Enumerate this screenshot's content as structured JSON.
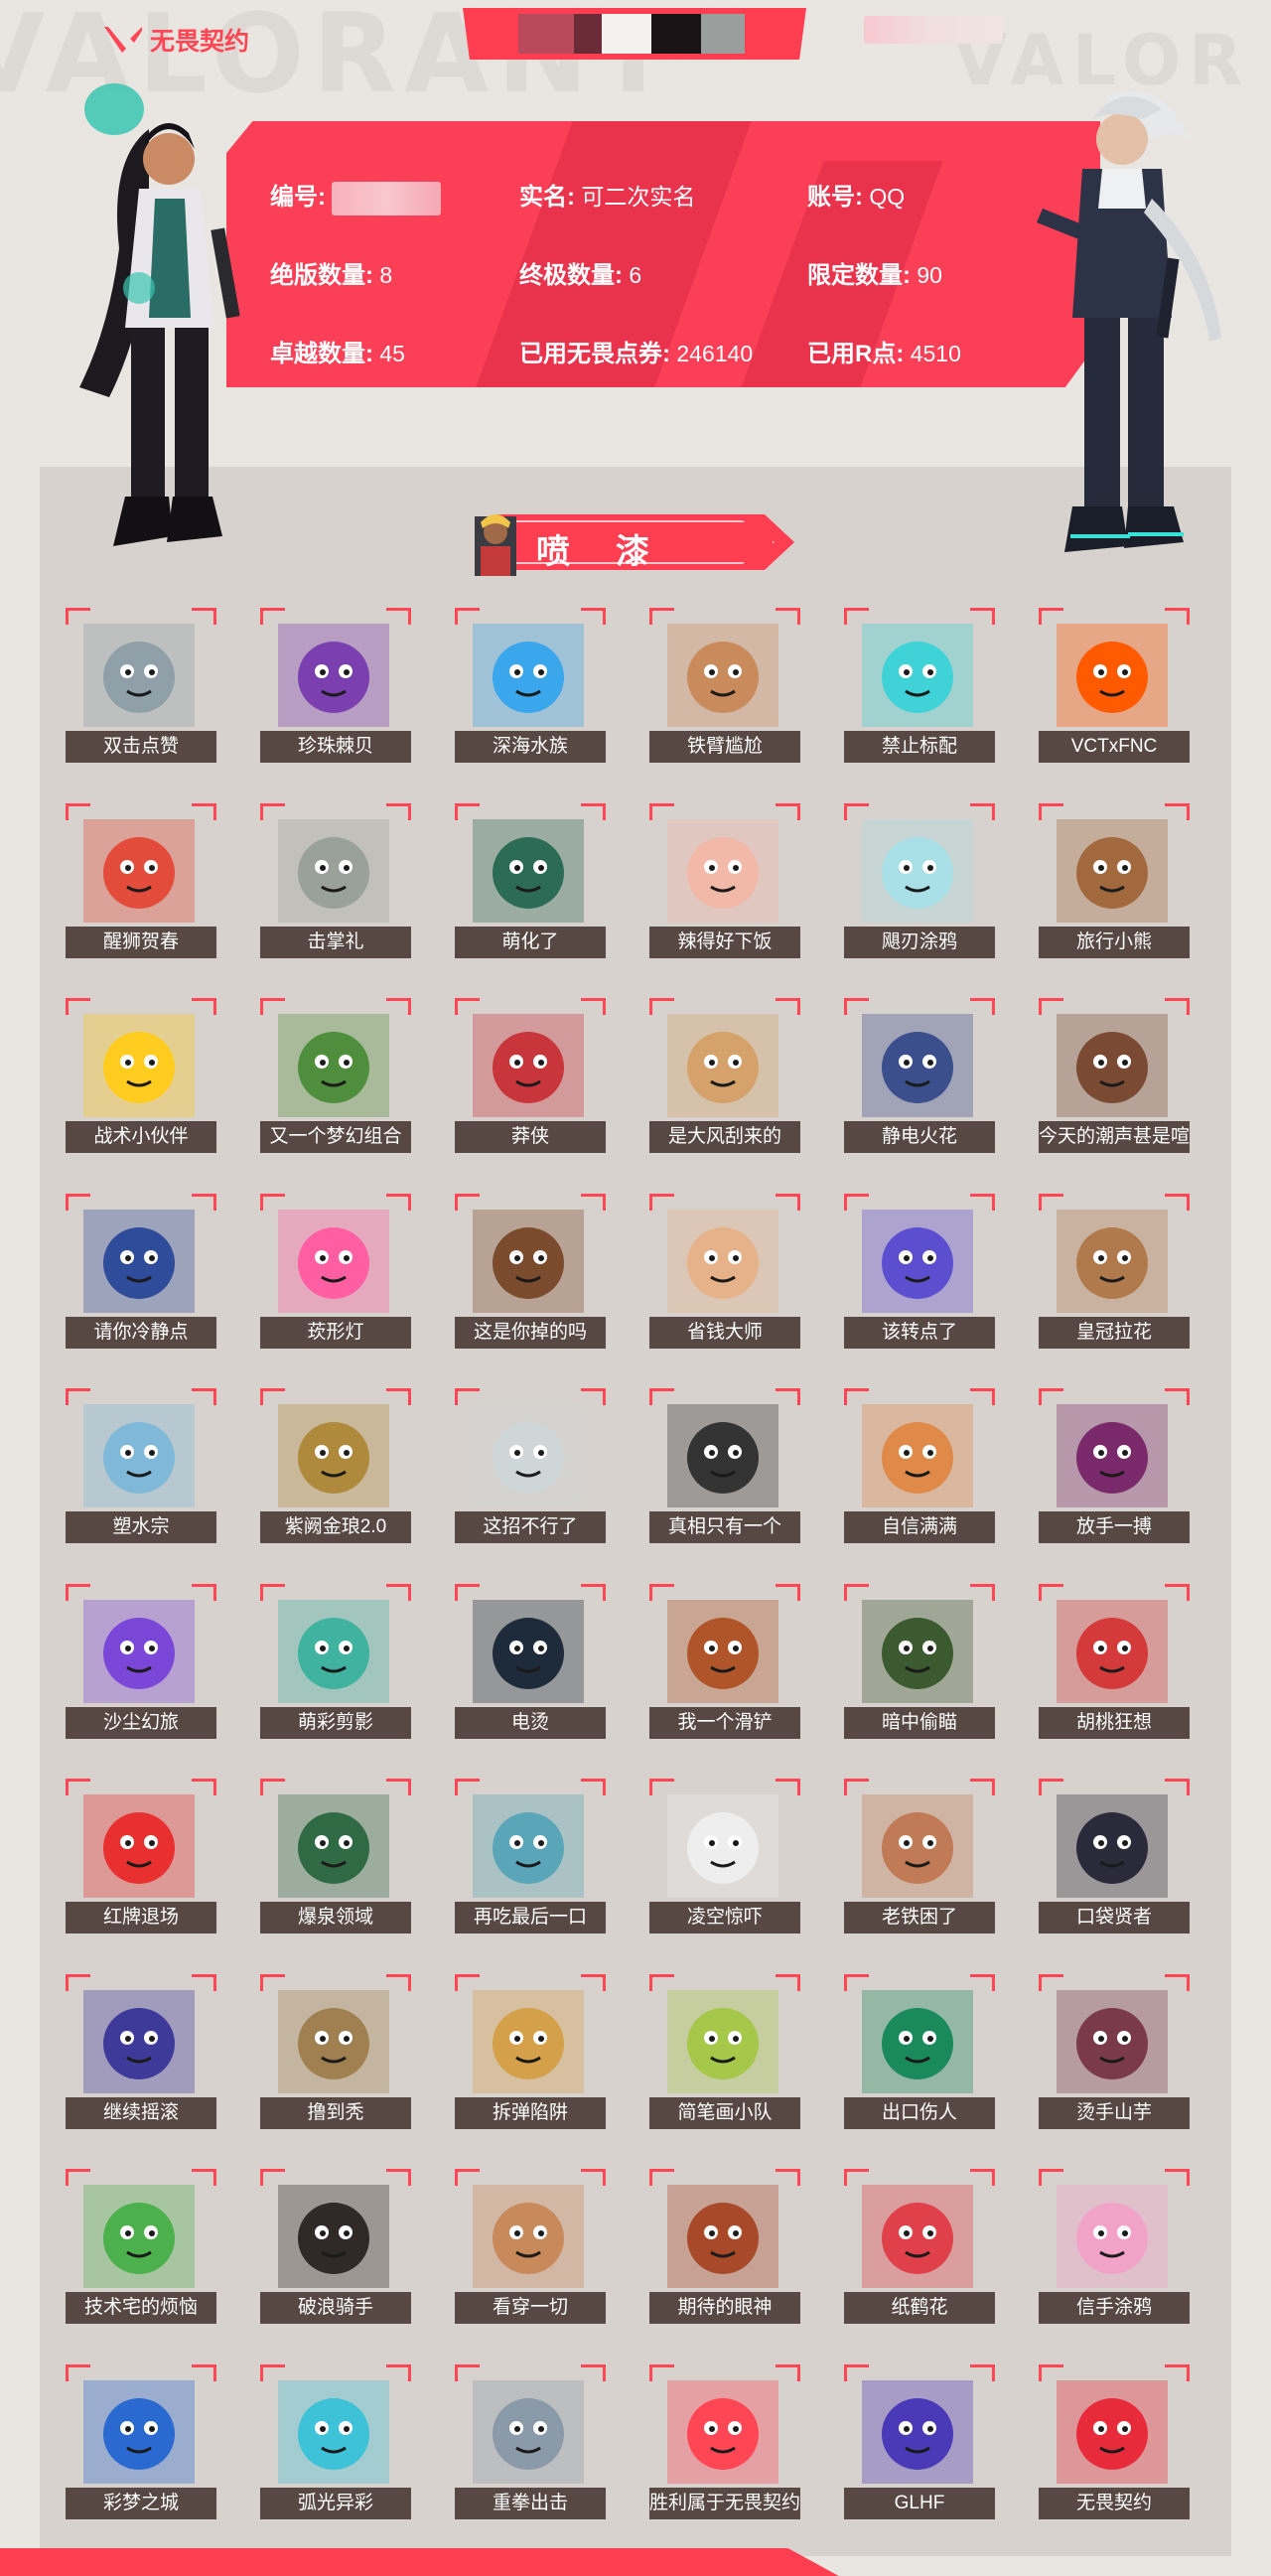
{
  "header": {
    "logo_text": "无畏契约",
    "brand_color": "#ff4655",
    "banner_color": "#ff3e52",
    "censor_colors": [
      "#b84a5c",
      "#1a1416",
      "#f4f2f0",
      "#3a3537",
      "#c9c9c9"
    ]
  },
  "account": {
    "id_label": "编号:",
    "realname_label": "实名:",
    "realname_value": "可二次实名",
    "account_label": "账号:",
    "account_value": "QQ",
    "discontinued_label": "绝版数量:",
    "discontinued_value": "8",
    "ultimate_label": "终极数量:",
    "ultimate_value": "6",
    "limited_label": "限定数量:",
    "limited_value": "90",
    "exclusive_label": "卓越数量:",
    "exclusive_value": "45",
    "vp_used_label": "已用无畏点券:",
    "vp_used_value": "246140",
    "rp_used_label": "已用R点:",
    "rp_used_value": "4510"
  },
  "section": {
    "title": "喷漆"
  },
  "sprays": [
    {
      "label": "双击点赞",
      "icon": "sage-face-icon",
      "color": "#8fa0a8"
    },
    {
      "label": "珍珠棘贝",
      "icon": "pearl-shell-icon",
      "color": "#7b3fb0"
    },
    {
      "label": "深海水族",
      "icon": "sea-creature-icon",
      "color": "#3aa6ec"
    },
    {
      "label": "铁臂尴尬",
      "icon": "breach-face-icon",
      "color": "#c98a5c"
    },
    {
      "label": "禁止标配",
      "icon": "forbidden-sign-icon",
      "color": "#3fd3d8"
    },
    {
      "label": "VCTxFNC",
      "icon": "fnatic-logo-icon",
      "color": "#ff5a00"
    },
    {
      "label": "醒狮贺春",
      "icon": "lion-dance-icon",
      "color": "#e34b3a"
    },
    {
      "label": "击掌礼",
      "icon": "high-five-icon",
      "color": "#9aa19b"
    },
    {
      "label": "萌化了",
      "icon": "agent-cute-face-icon",
      "color": "#2c6b55"
    },
    {
      "label": "辣得好下饭",
      "icon": "spicy-face-icon",
      "color": "#f2b8a8"
    },
    {
      "label": "飓刃涂鸦",
      "icon": "jett-doodle-icon",
      "color": "#a9dfe6"
    },
    {
      "label": "旅行小熊",
      "icon": "travel-bear-icon",
      "color": "#a2693f"
    },
    {
      "label": "战术小伙伴",
      "icon": "rubber-duck-icon",
      "color": "#ffcc1f"
    },
    {
      "label": "又一个梦幻组合",
      "icon": "dream-team-icon",
      "color": "#4f8e3c"
    },
    {
      "label": "莽侠",
      "icon": "target-crosshair-icon",
      "color": "#c8353b"
    },
    {
      "label": "是大风刮来的",
      "icon": "windblown-face-icon",
      "color": "#d4a26a"
    },
    {
      "label": "静电火花",
      "icon": "static-spark-icon",
      "color": "#3a4f8c"
    },
    {
      "label": "今天的潮声甚是喧嚣",
      "icon": "harbor-face-icon",
      "color": "#7a4a33"
    },
    {
      "label": "请你冷静点",
      "icon": "angry-face-icon",
      "color": "#2e4c9a"
    },
    {
      "label": "莰形灯",
      "icon": "heart-lamp-icon",
      "color": "#ff5fa2"
    },
    {
      "label": "这是你掉的吗",
      "icon": "surprised-face-icon",
      "color": "#7a4b2c"
    },
    {
      "label": "省钱大师",
      "icon": "glasses-face-icon",
      "color": "#e6b28a"
    },
    {
      "label": "该转点了",
      "icon": "rotate-arrows-icon",
      "color": "#5b4fd0"
    },
    {
      "label": "皇冠拉花",
      "icon": "latte-art-icon",
      "color": "#b07a4c"
    },
    {
      "label": "塑水宗",
      "icon": "water-glyph-icon",
      "color": "#7fb8d8"
    },
    {
      "label": "紫阙金琅2.0",
      "icon": "golden-emblem-icon",
      "color": "#b08a3c"
    },
    {
      "label": "这招不行了",
      "icon": "grey-hair-face-icon",
      "color": "#cfd6d8"
    },
    {
      "label": "真相只有一个",
      "icon": "detective-face-icon",
      "color": "#333333"
    },
    {
      "label": "自信满满",
      "icon": "confident-face-icon",
      "color": "#e08a4a"
    },
    {
      "label": "放手一搏",
      "icon": "grin-face-icon",
      "color": "#7a2a6a"
    },
    {
      "label": "沙尘幻旅",
      "icon": "peace-sign-icon",
      "color": "#7b47d8"
    },
    {
      "label": "萌彩剪影",
      "icon": "silhouette-icon",
      "color": "#3fb2a0"
    },
    {
      "label": "电烫",
      "icon": "masked-agent-icon",
      "color": "#1d2b3a"
    },
    {
      "label": "我一个滑铲",
      "icon": "slide-agent-icon",
      "color": "#b0552a"
    },
    {
      "label": "暗中偷瞄",
      "icon": "peeking-bear-icon",
      "color": "#3c5a30"
    },
    {
      "label": "胡桃狂想",
      "icon": "nutcracker-icon",
      "color": "#d43a3a"
    },
    {
      "label": "红牌退场",
      "icon": "red-card-icon",
      "color": "#e83030"
    },
    {
      "label": "爆泉领域",
      "icon": "spiral-eyes-icon",
      "color": "#2f6a44"
    },
    {
      "label": "再吃最后一口",
      "icon": "robot-face-icon",
      "color": "#5aa6b8"
    },
    {
      "label": "凌空惊吓",
      "icon": "ghost-icon",
      "color": "#eeeeee"
    },
    {
      "label": "老铁困了",
      "icon": "sleepy-face-icon",
      "color": "#c07a55"
    },
    {
      "label": "口袋贤者",
      "icon": "sparkle-eyes-icon",
      "color": "#2a2a3a"
    },
    {
      "label": "继续摇滚",
      "icon": "rock-face-icon",
      "color": "#3d3a9a"
    },
    {
      "label": "撸到秃",
      "icon": "owl-face-icon",
      "color": "#a08050"
    },
    {
      "label": "拆弹陷阱",
      "icon": "bomb-robot-icon",
      "color": "#d4a04a"
    },
    {
      "label": "简笔画小队",
      "icon": "doodle-bird-icon",
      "color": "#a6c84a"
    },
    {
      "label": "出口伤人",
      "icon": "viper-chibi-icon",
      "color": "#1a8a5a"
    },
    {
      "label": "烫手山芋",
      "icon": "hot-potato-icon",
      "color": "#7a3a4a"
    },
    {
      "label": "技术宅的烦恼",
      "icon": "nerd-face-icon",
      "color": "#4cb04c"
    },
    {
      "label": "破浪骑手",
      "icon": "sunglasses-face-icon",
      "color": "#2f2a28"
    },
    {
      "label": "看穿一切",
      "icon": "smug-face-icon",
      "color": "#c88a5a"
    },
    {
      "label": "期待的眼神",
      "icon": "glowing-eyes-icon",
      "color": "#a84a2a"
    },
    {
      "label": "纸鹤花",
      "icon": "paper-crane-icon",
      "color": "#e0404a"
    },
    {
      "label": "信手涂鸦",
      "icon": "graffiti-tag-icon",
      "color": "#f2a3c8"
    },
    {
      "label": "彩梦之城",
      "icon": "rainbow-logo-icon",
      "color": "#2a6ad0"
    },
    {
      "label": "弧光异彩",
      "icon": "arc-x-icon",
      "color": "#3ec2d8"
    },
    {
      "label": "重拳出击",
      "icon": "boxing-koala-icon",
      "color": "#8a9aa8"
    },
    {
      "label": "胜利属于无畏契约",
      "icon": "valorant-v-icon",
      "color": "#ff4655"
    },
    {
      "label": "GLHF",
      "icon": "glhf-graffiti-icon",
      "color": "#4a3ab8"
    },
    {
      "label": "无畏契约",
      "icon": "valorant-badge-icon",
      "color": "#e82b3a"
    }
  ]
}
